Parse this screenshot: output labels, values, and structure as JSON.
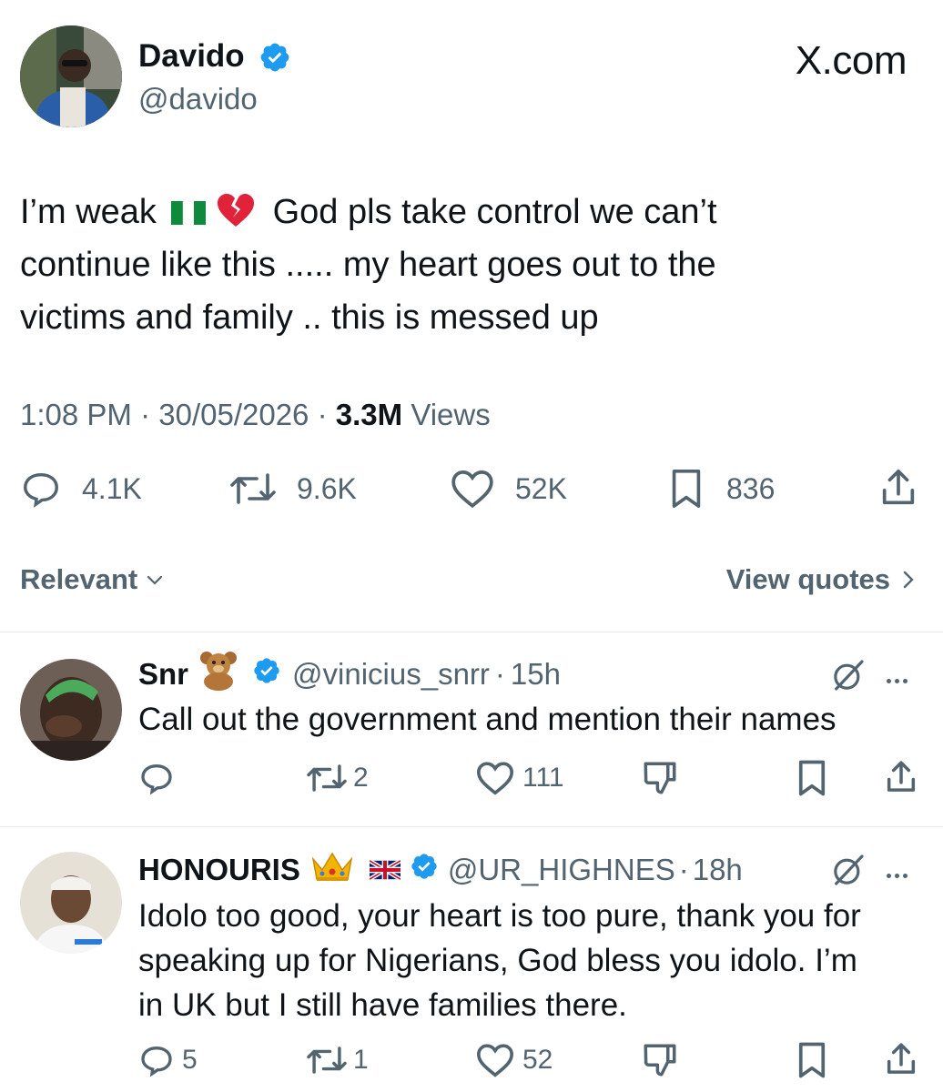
{
  "brand": {
    "label": "X.com"
  },
  "tweet": {
    "author": {
      "name": "Davido",
      "handle": "@davido"
    },
    "text": {
      "line1_start": "I’m weak",
      "line1_end": "God pls take control we can’t",
      "line2": "continue like this ..... my heart goes out to the",
      "line3": "victims and family .. this is messed up"
    },
    "meta": {
      "time": "1:08 PM",
      "date": "30/05/2026",
      "views_count": "3.3M",
      "views_label": "Views",
      "sep": "·"
    },
    "stats": {
      "replies": "4.1K",
      "reposts": "9.6K",
      "likes": "52K",
      "bookmarks": "836"
    }
  },
  "filter": {
    "sort_label": "Relevant",
    "quotes_label": "View quotes"
  },
  "replies": [
    {
      "name": "Snr",
      "handle": "@vinicius_snrr",
      "time": "15h",
      "sep": "·",
      "text": "Call out the government and mention their names",
      "stats": {
        "replies": "",
        "reposts": "2",
        "likes": "111"
      }
    },
    {
      "name": "HONOURIS",
      "handle": "@UR_HIGHNES",
      "time": "18h",
      "sep": "·",
      "text_lines": [
        "Idolo too good, your heart is too pure, thank you for",
        "speaking up for Nigerians, God bless you idolo. I’m",
        "in UK but I still have families there."
      ],
      "stats": {
        "replies": "5",
        "reposts": "1",
        "likes": "52"
      }
    }
  ],
  "colors": {
    "verified": "#1d9bf0",
    "muted": "#536471",
    "divider": "#e6e9eb"
  }
}
